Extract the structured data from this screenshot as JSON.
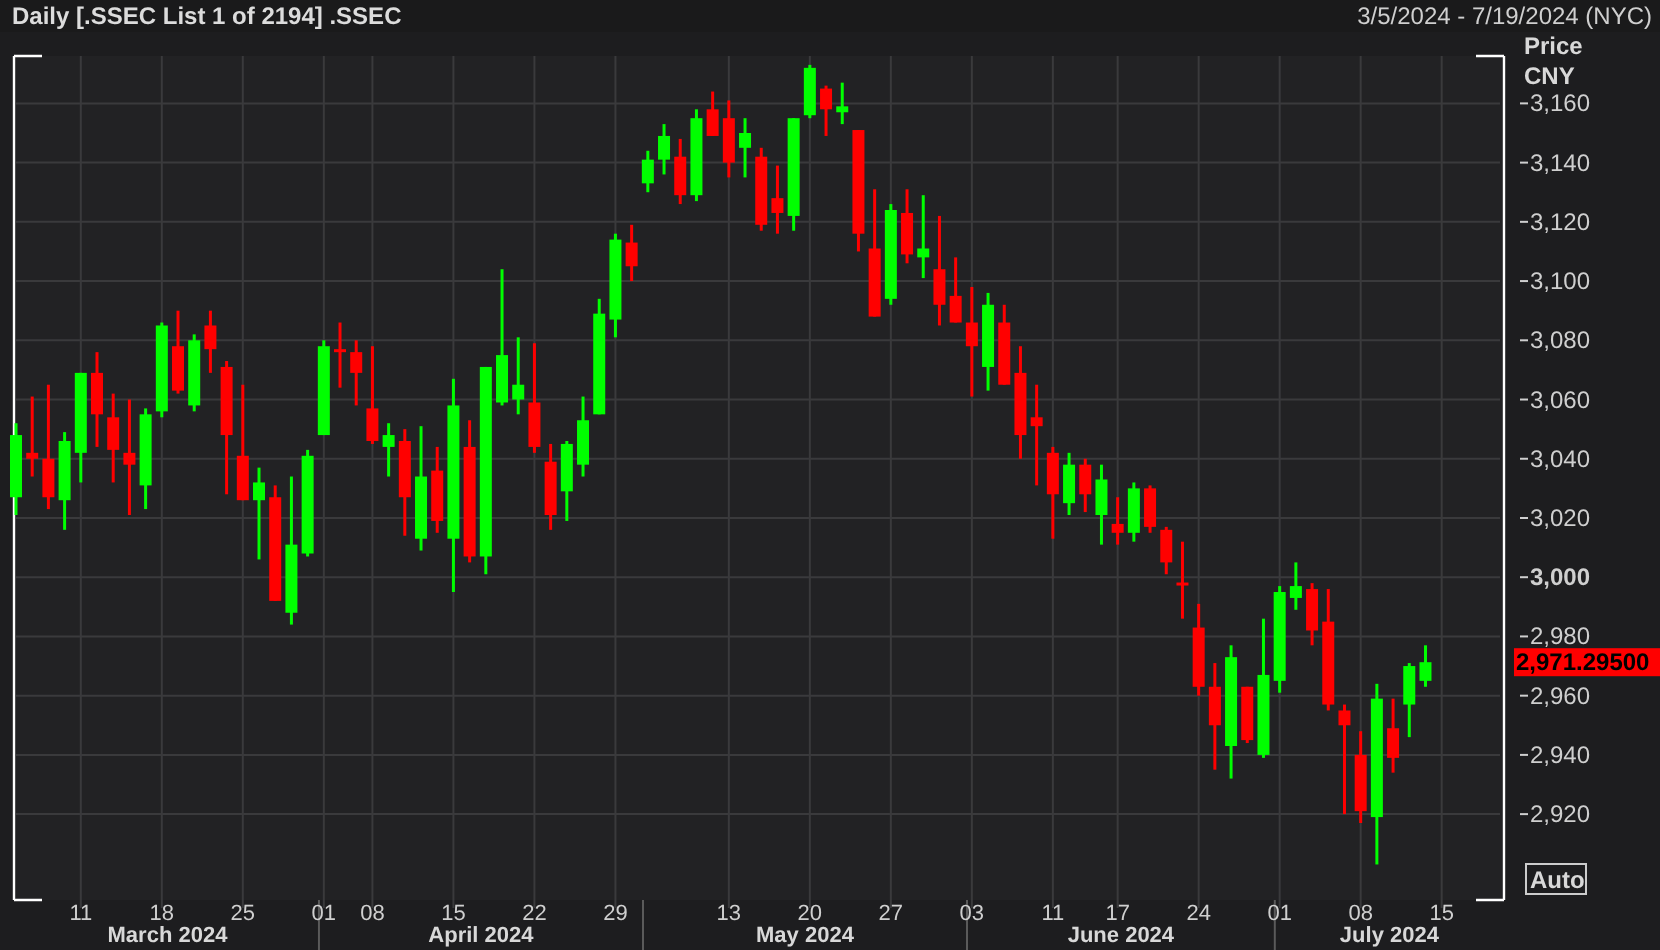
{
  "header": {
    "title": "Daily [.SSEC List 1 of 2194] .SSEC",
    "date_range": "3/5/2024 - 7/19/2024 (NYC)"
  },
  "chart": {
    "axis_title": "Price",
    "currency": "CNY",
    "last_price": "2,971.29500",
    "autoscale_button": "Auto",
    "chart_data": {
      "type": "candlestick",
      "grid": true,
      "ylim": [
        2891,
        3176
      ],
      "yticks": [
        {
          "value": 2920,
          "label": "2,920"
        },
        {
          "value": 2940,
          "label": "2,940"
        },
        {
          "value": 2960,
          "label": "2,960"
        },
        {
          "value": 2980,
          "label": "2,980"
        },
        {
          "value": 3000,
          "label": "3,000"
        },
        {
          "value": 3020,
          "label": "3,020"
        },
        {
          "value": 3040,
          "label": "3,040"
        },
        {
          "value": 3060,
          "label": "3,060"
        },
        {
          "value": 3080,
          "label": "3,080"
        },
        {
          "value": 3100,
          "label": "3,100"
        },
        {
          "value": 3120,
          "label": "3,120"
        },
        {
          "value": 3140,
          "label": "3,140"
        },
        {
          "value": 3160,
          "label": "3,160"
        }
      ],
      "annotations": [
        "March 2024",
        "April 2024",
        "May 2024",
        "June 2024",
        "July 2024"
      ],
      "categories": [
        null,
        null,
        null,
        null,
        "11",
        null,
        null,
        null,
        null,
        "18",
        null,
        null,
        null,
        null,
        "25",
        null,
        null,
        null,
        null,
        "01",
        null,
        null,
        "08",
        null,
        null,
        null,
        null,
        "15",
        null,
        null,
        null,
        null,
        "22",
        null,
        null,
        null,
        null,
        "29",
        null,
        null,
        null,
        null,
        null,
        null,
        "13",
        null,
        null,
        null,
        null,
        "20",
        null,
        null,
        null,
        null,
        "27",
        null,
        null,
        null,
        null,
        "03",
        null,
        null,
        null,
        null,
        "11",
        null,
        null,
        null,
        "17",
        null,
        null,
        null,
        null,
        "24",
        null,
        null,
        null,
        null,
        "01",
        null,
        null,
        null,
        null,
        "08",
        null,
        null,
        null,
        null,
        "15"
      ],
      "ohlc": [
        [
          3027,
          3052,
          3021,
          3048
        ],
        [
          3042,
          3061,
          3034,
          3040
        ],
        [
          3040,
          3065,
          3023,
          3027
        ],
        [
          3026,
          3049,
          3016,
          3046
        ],
        [
          3042,
          3069,
          3032,
          3069
        ],
        [
          3069,
          3076,
          3044,
          3055
        ],
        [
          3054,
          3062,
          3032,
          3043
        ],
        [
          3042,
          3060,
          3021,
          3038
        ],
        [
          3031,
          3057,
          3023,
          3055
        ],
        [
          3056,
          3086,
          3054,
          3085
        ],
        [
          3078,
          3090,
          3062,
          3063
        ],
        [
          3058,
          3082,
          3056,
          3080
        ],
        [
          3085,
          3090,
          3069,
          3077
        ],
        [
          3071,
          3073,
          3028,
          3048
        ],
        [
          3041,
          3065,
          3026,
          3026
        ],
        [
          3026,
          3037,
          3006,
          3032
        ],
        [
          3027,
          3031,
          2992,
          2992
        ],
        [
          2988,
          3034,
          2984,
          3011
        ],
        [
          3008,
          3043,
          3007,
          3041
        ],
        [
          3048,
          3080,
          3048,
          3078
        ],
        [
          3077,
          3086,
          3064,
          3076
        ],
        [
          3076,
          3080,
          3058,
          3069
        ],
        [
          3057,
          3078,
          3045,
          3046
        ],
        [
          3044,
          3052,
          3034,
          3048
        ],
        [
          3046,
          3050,
          3014,
          3027
        ],
        [
          3013,
          3051,
          3009,
          3034
        ],
        [
          3036,
          3044,
          3015,
          3019
        ],
        [
          3013,
          3067,
          2995,
          3058
        ],
        [
          3044,
          3053,
          3005,
          3007
        ],
        [
          3007,
          3071,
          3001,
          3071
        ],
        [
          3059,
          3104,
          3058,
          3075
        ],
        [
          3060,
          3081,
          3055,
          3065
        ],
        [
          3059,
          3079,
          3042,
          3044
        ],
        [
          3039,
          3045,
          3016,
          3021
        ],
        [
          3029,
          3046,
          3019,
          3045
        ],
        [
          3038,
          3061,
          3034,
          3053
        ],
        [
          3055,
          3094,
          3055,
          3089
        ],
        [
          3087,
          3116,
          3081,
          3114
        ],
        [
          3113,
          3119,
          3100,
          3105
        ],
        [
          3133,
          3144,
          3130,
          3141
        ],
        [
          3141,
          3153,
          3136,
          3149
        ],
        [
          3142,
          3148,
          3126,
          3129
        ],
        [
          3129,
          3158,
          3127,
          3155
        ],
        [
          3158,
          3164,
          3149,
          3149
        ],
        [
          3155,
          3161,
          3135,
          3140
        ],
        [
          3145,
          3155,
          3135,
          3150
        ],
        [
          3142,
          3145,
          3117,
          3119
        ],
        [
          3128,
          3139,
          3116,
          3123
        ],
        [
          3122,
          3155,
          3117,
          3155
        ],
        [
          3156,
          3173,
          3155,
          3172
        ],
        [
          3165,
          3166,
          3149,
          3158
        ],
        [
          3157,
          3167,
          3153,
          3159
        ],
        [
          3151,
          3151,
          3110,
          3116
        ],
        [
          3111,
          3131,
          3088,
          3088
        ],
        [
          3094,
          3126,
          3092,
          3124
        ],
        [
          3123,
          3131,
          3106,
          3109
        ],
        [
          3108,
          3129,
          3101,
          3111
        ],
        [
          3104,
          3122,
          3085,
          3092
        ],
        [
          3095,
          3108,
          3086,
          3086
        ],
        [
          3086,
          3098,
          3061,
          3078
        ],
        [
          3071,
          3096,
          3063,
          3092
        ],
        [
          3086,
          3092,
          3065,
          3065
        ],
        [
          3069,
          3078,
          3040,
          3048
        ],
        [
          3054,
          3065,
          3031,
          3051
        ],
        [
          3042,
          3044,
          3013,
          3028
        ],
        [
          3025,
          3042,
          3021,
          3038
        ],
        [
          3038,
          3040,
          3022,
          3028
        ],
        [
          3021,
          3038,
          3011,
          3033
        ],
        [
          3018,
          3027,
          3011,
          3015
        ],
        [
          3015,
          3032,
          3012,
          3030
        ],
        [
          3030,
          3031,
          3015,
          3017
        ],
        [
          3016,
          3017,
          3001,
          3005
        ],
        [
          2998.2,
          3012,
          2986,
          2997.6
        ],
        [
          2983,
          2991,
          2960,
          2963
        ],
        [
          2963,
          2971,
          2935,
          2950
        ],
        [
          2943,
          2977,
          2932,
          2973
        ],
        [
          2963,
          2963,
          2944,
          2945
        ],
        [
          2940,
          2986,
          2939,
          2967
        ],
        [
          2965,
          2997,
          2961,
          2995
        ],
        [
          2993,
          3005,
          2989,
          2997
        ],
        [
          2996,
          2998,
          2977,
          2982
        ],
        [
          2985,
          2996,
          2955,
          2957
        ],
        [
          2955,
          2957,
          2920,
          2950
        ],
        [
          2940,
          2948,
          2917,
          2921
        ],
        [
          2919,
          2964,
          2903,
          2959
        ],
        [
          2949,
          2959,
          2934,
          2939
        ],
        [
          2957,
          2971,
          2946,
          2970
        ],
        [
          2965,
          2977,
          2963,
          2971.3
        ],
        null
      ]
    }
  }
}
